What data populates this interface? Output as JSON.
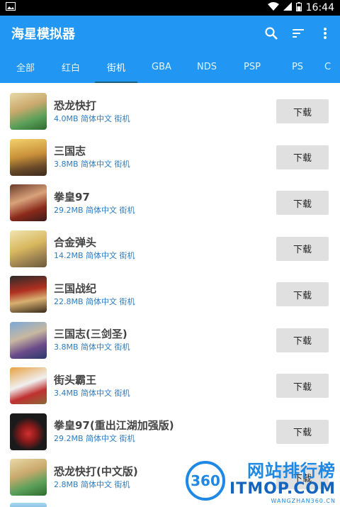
{
  "status_bar": {
    "time": "16:44",
    "left_icon": "image-notification-icon",
    "icons": [
      "wifi-icon",
      "signal-icon",
      "battery-icon"
    ]
  },
  "app_bar": {
    "title": "海星模拟器",
    "actions": [
      "search-icon",
      "sort-icon",
      "more-vert-icon"
    ]
  },
  "tabs": [
    {
      "label": "全部"
    },
    {
      "label": "红白"
    },
    {
      "label": "街机",
      "active": true
    },
    {
      "label": "GBA"
    },
    {
      "label": "NDS"
    },
    {
      "label": "PSP"
    },
    {
      "label": "PS"
    },
    {
      "label": "C"
    }
  ],
  "games": [
    {
      "name": "恐龙快打",
      "meta": "4.0MB 简体中文 街机",
      "button": "下载"
    },
    {
      "name": "三国志",
      "meta": "3.8MB 简体中文 街机",
      "button": "下载"
    },
    {
      "name": "拳皇97",
      "meta": "29.2MB 简体中文 街机",
      "button": "下载"
    },
    {
      "name": "合金弹头",
      "meta": "14.2MB 简体中文 街机",
      "button": "下载"
    },
    {
      "name": "三国战纪",
      "meta": "22.8MB 简体中文 街机",
      "button": "下载"
    },
    {
      "name": "三国志(三剑圣)",
      "meta": "3.8MB 简体中文 街机",
      "button": "下载"
    },
    {
      "name": "街头霸王",
      "meta": "3.4MB 简体中文 街机",
      "button": "下载"
    },
    {
      "name": "拳皇97(重出江湖加强版)",
      "meta": "29.2MB 简体中文 街机",
      "button": "下载"
    },
    {
      "name": "恐龙快打(中文版)",
      "meta": "2.8MB 简体中文 街机",
      "button": "下载"
    }
  ],
  "watermark": {
    "logo": "360",
    "line1": "网站排行榜",
    "line2": "ITMOP.COM",
    "line3": "WANGZHAN360.CN"
  },
  "colors": {
    "primary": "#2196f3",
    "meta_text": "#2d7cc1",
    "button_bg": "#e0e0e0"
  }
}
